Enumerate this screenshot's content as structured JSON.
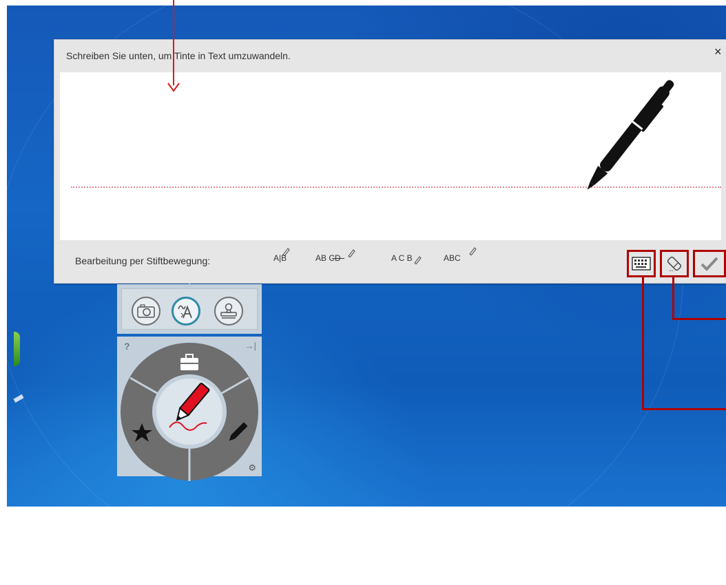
{
  "handwriting_panel": {
    "title": "Schreiben Sie unten, um Tinte in Text umzuwandeln.",
    "close_symbol": "×",
    "gesture_label": "Bearbeitung per Stiftbewegung:",
    "gestures": [
      {
        "icon": "split-gesture-icon",
        "text": "A|B"
      },
      {
        "icon": "delete-gesture-icon",
        "text": "AB CD"
      },
      {
        "icon": "insert-gesture-icon",
        "text": "A C B"
      },
      {
        "icon": "join-gesture-icon",
        "text": "ABC"
      }
    ],
    "buttons": [
      {
        "name": "keyboard-button",
        "icon": "keyboard-icon"
      },
      {
        "name": "eraser-button",
        "icon": "eraser-icon"
      },
      {
        "name": "confirm-button",
        "icon": "checkmark-icon"
      }
    ]
  },
  "mode_bar": {
    "modes": [
      {
        "name": "camera-mode",
        "icon": "camera-icon"
      },
      {
        "name": "ink-to-text-mode",
        "icon": "ink-to-text-icon",
        "active": true
      },
      {
        "name": "stamp-mode",
        "icon": "stamp-icon"
      }
    ]
  },
  "tool_wheel": {
    "help": "?",
    "pin": "→|",
    "segments": [
      "toolbox-icon",
      "star-icon",
      "pencil-icon"
    ],
    "center": "red-pen-icon",
    "settings": "gear-icon"
  },
  "colors": {
    "annotation_red": "#b00000",
    "arrow_red": "#d81818",
    "ink_pen_red": "#e01020",
    "wheel_gray": "#6e6e6e",
    "active_ring": "#2e8ba8"
  }
}
